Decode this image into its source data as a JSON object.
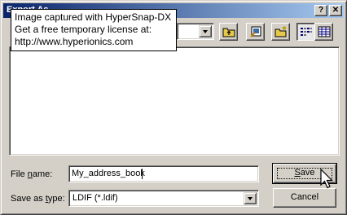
{
  "window": {
    "title": "Export As",
    "help_icon": "question-mark",
    "close_icon": "x"
  },
  "toolbar": {
    "icons": [
      "up-one-level-icon",
      "desktop-icon",
      "new-folder-icon",
      "list-view-icon",
      "details-view-icon"
    ]
  },
  "fields": {
    "file_name_label_before": "File ",
    "file_name_label_underlined": "n",
    "file_name_label_after": "ame:",
    "file_name_value": "My_address_book",
    "save_as_type_label_before": "Save as ",
    "save_as_type_label_underlined": "t",
    "save_as_type_label_after": "ype:",
    "save_as_type_value": "LDIF (*.ldif)"
  },
  "buttons": {
    "save_underlined": "S",
    "save_rest": "ave",
    "cancel_label": "Cancel"
  },
  "watermark": {
    "line1": "Image captured with HyperSnap-DX",
    "line2": "Get a free temporary license at:",
    "line3": "http://www.hyperionics.com"
  }
}
